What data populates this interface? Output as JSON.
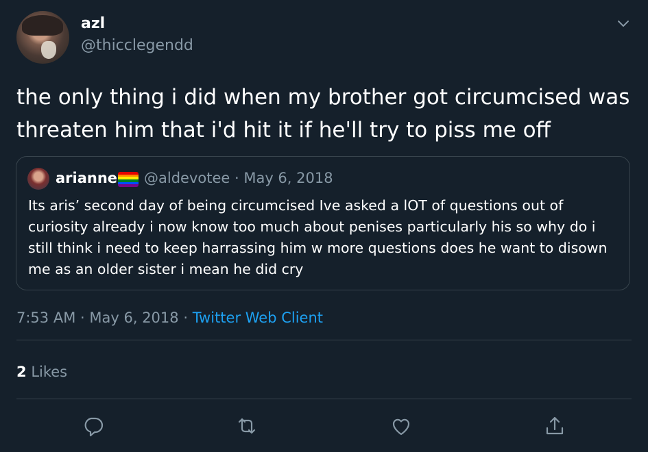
{
  "author": {
    "name": "azl",
    "handle": "@thicclegendd"
  },
  "tweet": {
    "text": "the only thing i did when my brother got circumcised was threaten him that i'd hit it if he'll try to piss me off",
    "time": "7:53 AM",
    "date": "May 6, 2018",
    "separator": "·",
    "source": "Twitter Web Client"
  },
  "quoted": {
    "name": "arianne",
    "handle_date": "@aldevotee · May 6, 2018",
    "text": "Its aris’ second day of being circumcised Ive asked a lOT of questions out of curiosity already i now know too much about penises particularly his so why do i still think i need to keep harrassing him w more questions does he want to disown me as an older sister i mean he did cry",
    "flag_colors": [
      "#e40303",
      "#ff8c00",
      "#ffed00",
      "#008026",
      "#004dff",
      "#750787"
    ]
  },
  "stats": {
    "likes_count": "2",
    "likes_label": "Likes"
  },
  "actions": {
    "icons": [
      "reply-icon",
      "retweet-icon",
      "like-icon",
      "share-icon"
    ]
  },
  "colors": {
    "background": "#15202b",
    "secondary_text": "#8899a6",
    "link": "#1da1f2",
    "border": "#38444d"
  }
}
